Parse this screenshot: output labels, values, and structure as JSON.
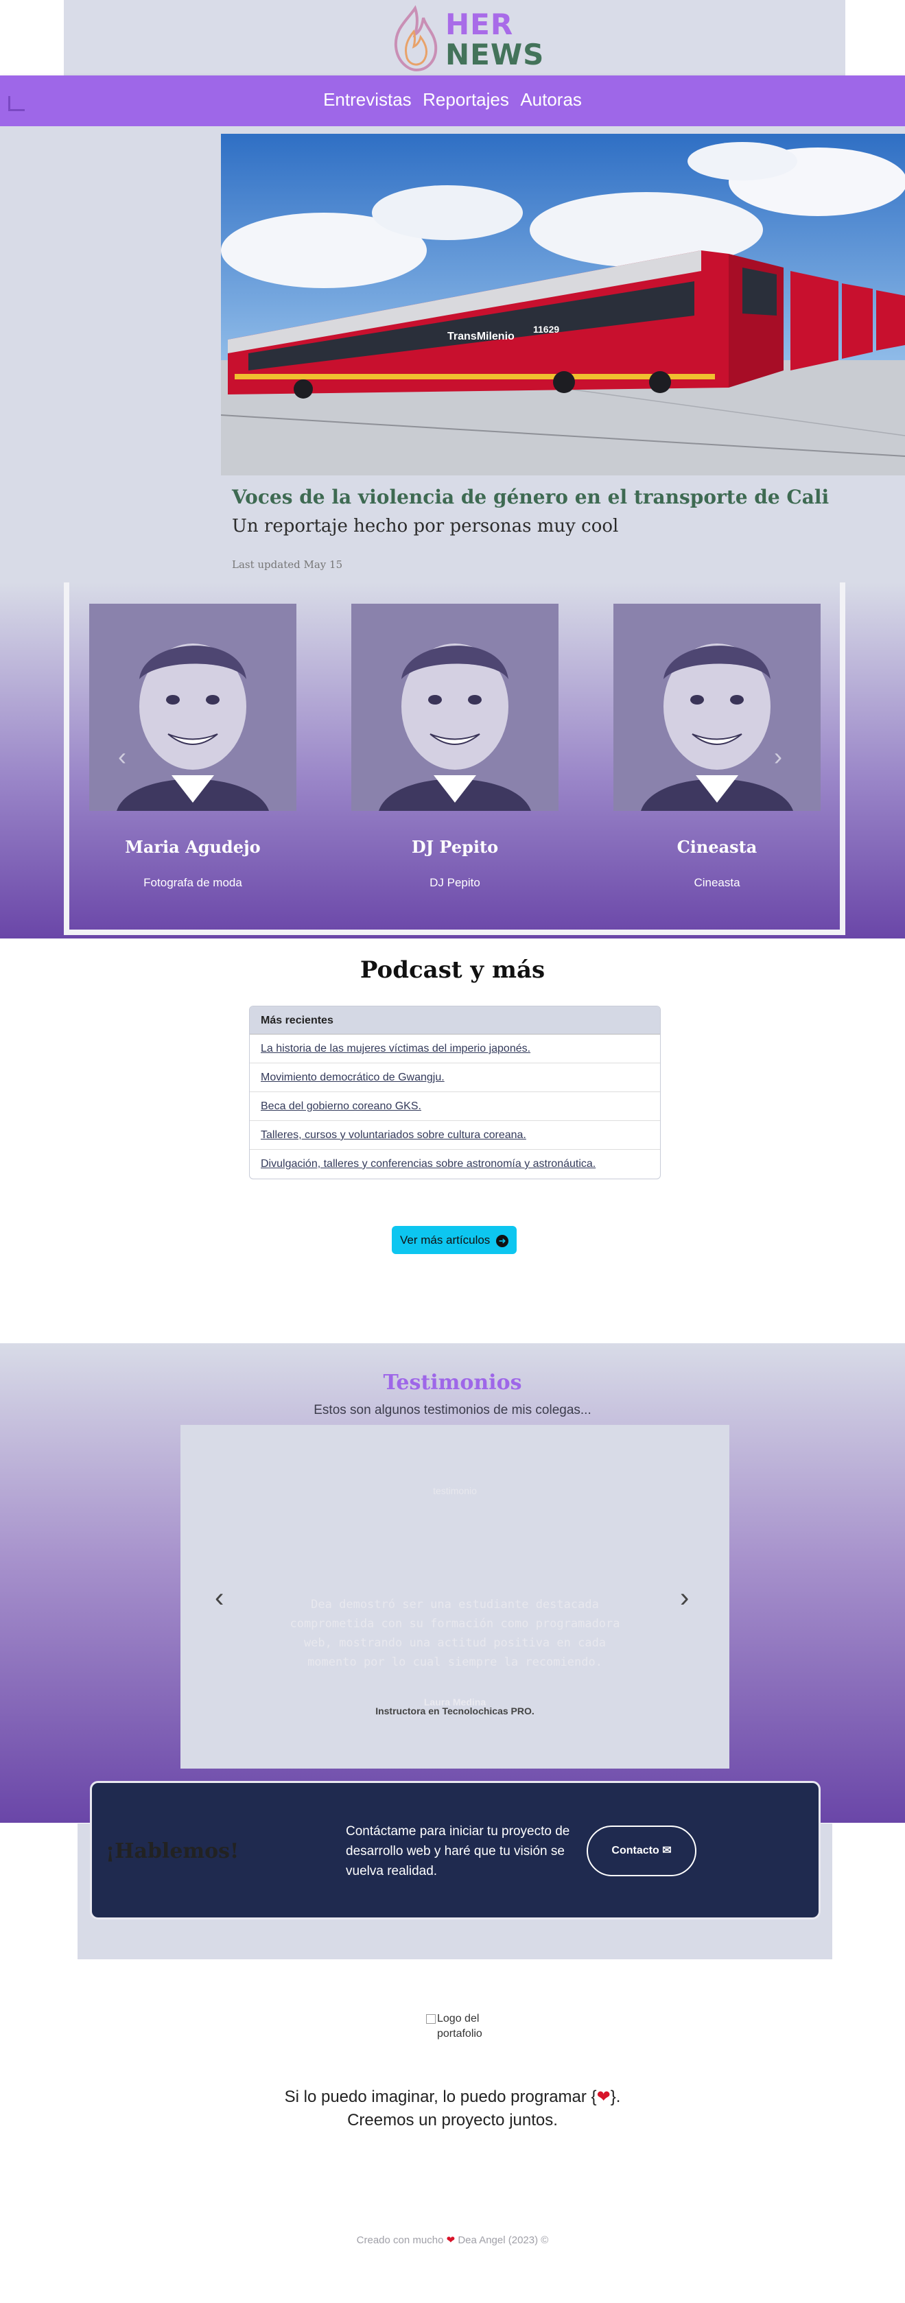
{
  "brand": {
    "line1": "HER",
    "line2": "NEWS"
  },
  "nav": {
    "items": [
      "Entrevistas",
      "Reportajes",
      "Autoras"
    ]
  },
  "feature": {
    "image_alt": "red buses",
    "bus_text": "TransMilenio",
    "bus_number": "11629",
    "title": "Voces de la violencia de género en el transporte de Cali",
    "subtitle": "Un reportaje hecho por personas muy cool",
    "updated": "Last updated May 15"
  },
  "team": {
    "members": [
      {
        "name": "Maria Agudejo",
        "role": "Fotografa de moda"
      },
      {
        "name": "DJ Pepito",
        "role": "DJ Pepito"
      },
      {
        "name": "Cineasta",
        "role": "Cineasta"
      }
    ],
    "prev_icon": "chevron-left-icon",
    "next_icon": "chevron-right-icon"
  },
  "podcast": {
    "title": "Podcast y más",
    "list_header": "Más recientes",
    "items": [
      "La historia de las mujeres víctimas del imperio japonés.",
      "Movimiento democrático de Gwangju.",
      "Beca del gobierno coreano GKS.",
      "Talleres, cursos y voluntariados sobre cultura coreana.",
      "Divulgación, talleres y conferencias sobre astronomía y astronáutica."
    ],
    "more_button": "Ver más artículos",
    "more_icon": "arrow-right-circle-icon"
  },
  "testimonials": {
    "title": "Testimonios",
    "subtitle": "Estos son algunos testimonios de mis colegas...",
    "tag": "testimonio",
    "quote": "Dea demostró ser una estudiante destacada comprometida con su formación como programadora web, mostrando una actitud positiva en cada momento por lo cual siempre la recomiendo.",
    "author": "Laura Medina",
    "author_role": "Instructora en Tecnolochicas PRO."
  },
  "contact": {
    "greeting": "¡Hablemos!",
    "text": "Contáctame para iniciar tu proyecto de desarrollo web y haré que tu visión se vuelva realidad.",
    "button": "Contacto",
    "button_icon": "mail-icon"
  },
  "footer": {
    "logo_alt": "Logo del portafolio",
    "slogan_line1_a": "Si lo puedo imaginar, lo puedo programar {",
    "slogan_line1_b": "}.",
    "slogan_line2": "Creemos un proyecto juntos.",
    "credit_a": "Creado con mucho",
    "credit_b": "Dea Angel (2023) ©"
  },
  "colors": {
    "purple": "#9e67e8",
    "green": "#43735a",
    "navy": "#1f2a4f",
    "cyan": "#0dc6f0",
    "lavender": "#d8dbe7"
  }
}
